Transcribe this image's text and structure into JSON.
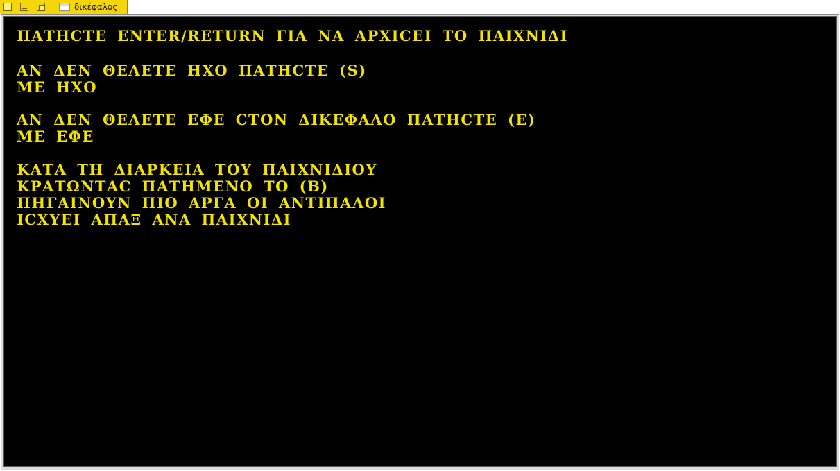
{
  "window": {
    "title": "δικέφαλος"
  },
  "icons": {
    "minimize": "minimize-icon",
    "restore": "restore-icon",
    "maximize": "maximize-icon",
    "app": "window-doc-icon"
  },
  "colors": {
    "titlebar_tab": "#f5d60a",
    "screen_background": "#000000",
    "text": "#f2e400"
  },
  "screen": {
    "lines": [
      "ΠΑΤΗCΤΕ ENTER/RETURN ΓΙΑ ΝΑ ΑΡΧΙCΕΙ ΤΟ ΠΑΙΧΝΙΔΙ",
      "ΑΝ ΔΕΝ ΘΕΛΕΤΕ ΗΧΟ ΠΑΤΗCΤΕ (S)",
      "ΜΕ ΗΧΟ",
      "ΑΝ ΔΕΝ ΘΕΛΕΤΕ ΕΦΕ CΤΟΝ ΔΙΚΕΦΑΛΟ ΠΑΤΗCΤΕ (Ε)",
      "ΜΕ ΕΦΕ",
      "ΚΑΤΑ ΤΗ ΔΙΑΡΚΕΙΑ ΤΟΥ ΠΑΙΧΝΙΔΙΟΥ",
      "ΚΡΑΤΩΝΤΑC ΠΑΤΗΜΕΝΟ ΤΟ (Β)",
      "ΠΗΓΑΙΝΟΥΝ ΠΙΟ ΑΡΓΑ ΟΙ ΑΝΤΙΠΑΛΟΙ",
      "ΙCΧΥΕΙ ΑΠΑΞ ΑΝΑ ΠΑΙΧΝΙΔΙ"
    ]
  }
}
